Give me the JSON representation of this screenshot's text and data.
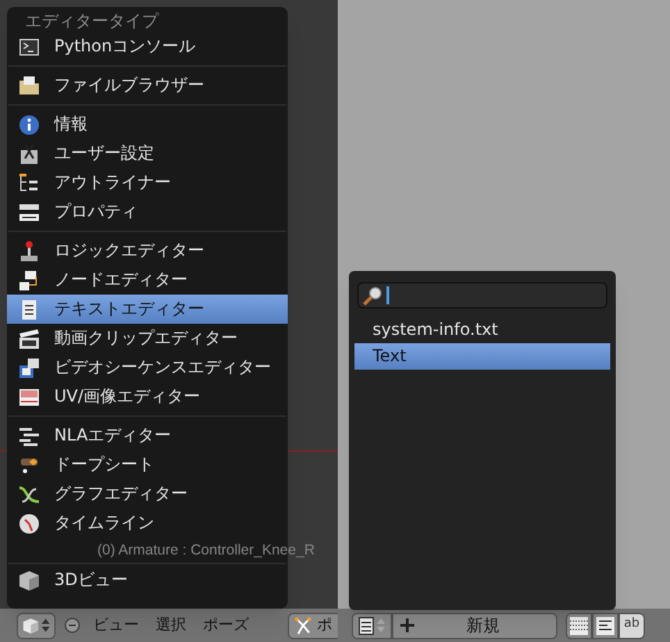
{
  "viewport": {
    "object_info": "(0) Armature : Controller_Knee_R"
  },
  "editor_type_menu": {
    "title": "エディタータイプ",
    "groups": [
      [
        {
          "label": "Pythonコンソール",
          "selected": false
        }
      ],
      [
        {
          "label": "ファイルブラウザー",
          "selected": false
        }
      ],
      [
        {
          "label": "情報",
          "selected": false
        },
        {
          "label": "ユーザー設定",
          "selected": false
        },
        {
          "label": "アウトライナー",
          "selected": false
        },
        {
          "label": "プロパティ",
          "selected": false
        }
      ],
      [
        {
          "label": "ロジックエディター",
          "selected": false
        },
        {
          "label": "ノードエディター",
          "selected": false
        },
        {
          "label": "テキストエディター",
          "selected": true
        },
        {
          "label": "動画クリップエディター",
          "selected": false
        },
        {
          "label": "ビデオシーケンスエディター",
          "selected": false
        },
        {
          "label": "UV/画像エディター",
          "selected": false
        }
      ],
      [
        {
          "label": "NLAエディター",
          "selected": false
        },
        {
          "label": "ドープシート",
          "selected": false
        },
        {
          "label": "グラフエディター",
          "selected": false
        },
        {
          "label": "タイムライン",
          "selected": false
        }
      ],
      [
        {
          "label": "3Dビュー",
          "selected": false
        }
      ]
    ]
  },
  "text_menu": {
    "items": [
      {
        "label": "system-info.txt",
        "selected": false
      },
      {
        "label": "Text",
        "selected": true
      }
    ]
  },
  "header": {
    "menus": [
      "ビュー",
      "選択",
      "ポーズ"
    ],
    "mode_button": "ポ",
    "new_button": "新規",
    "toggle_label": "ab"
  }
}
